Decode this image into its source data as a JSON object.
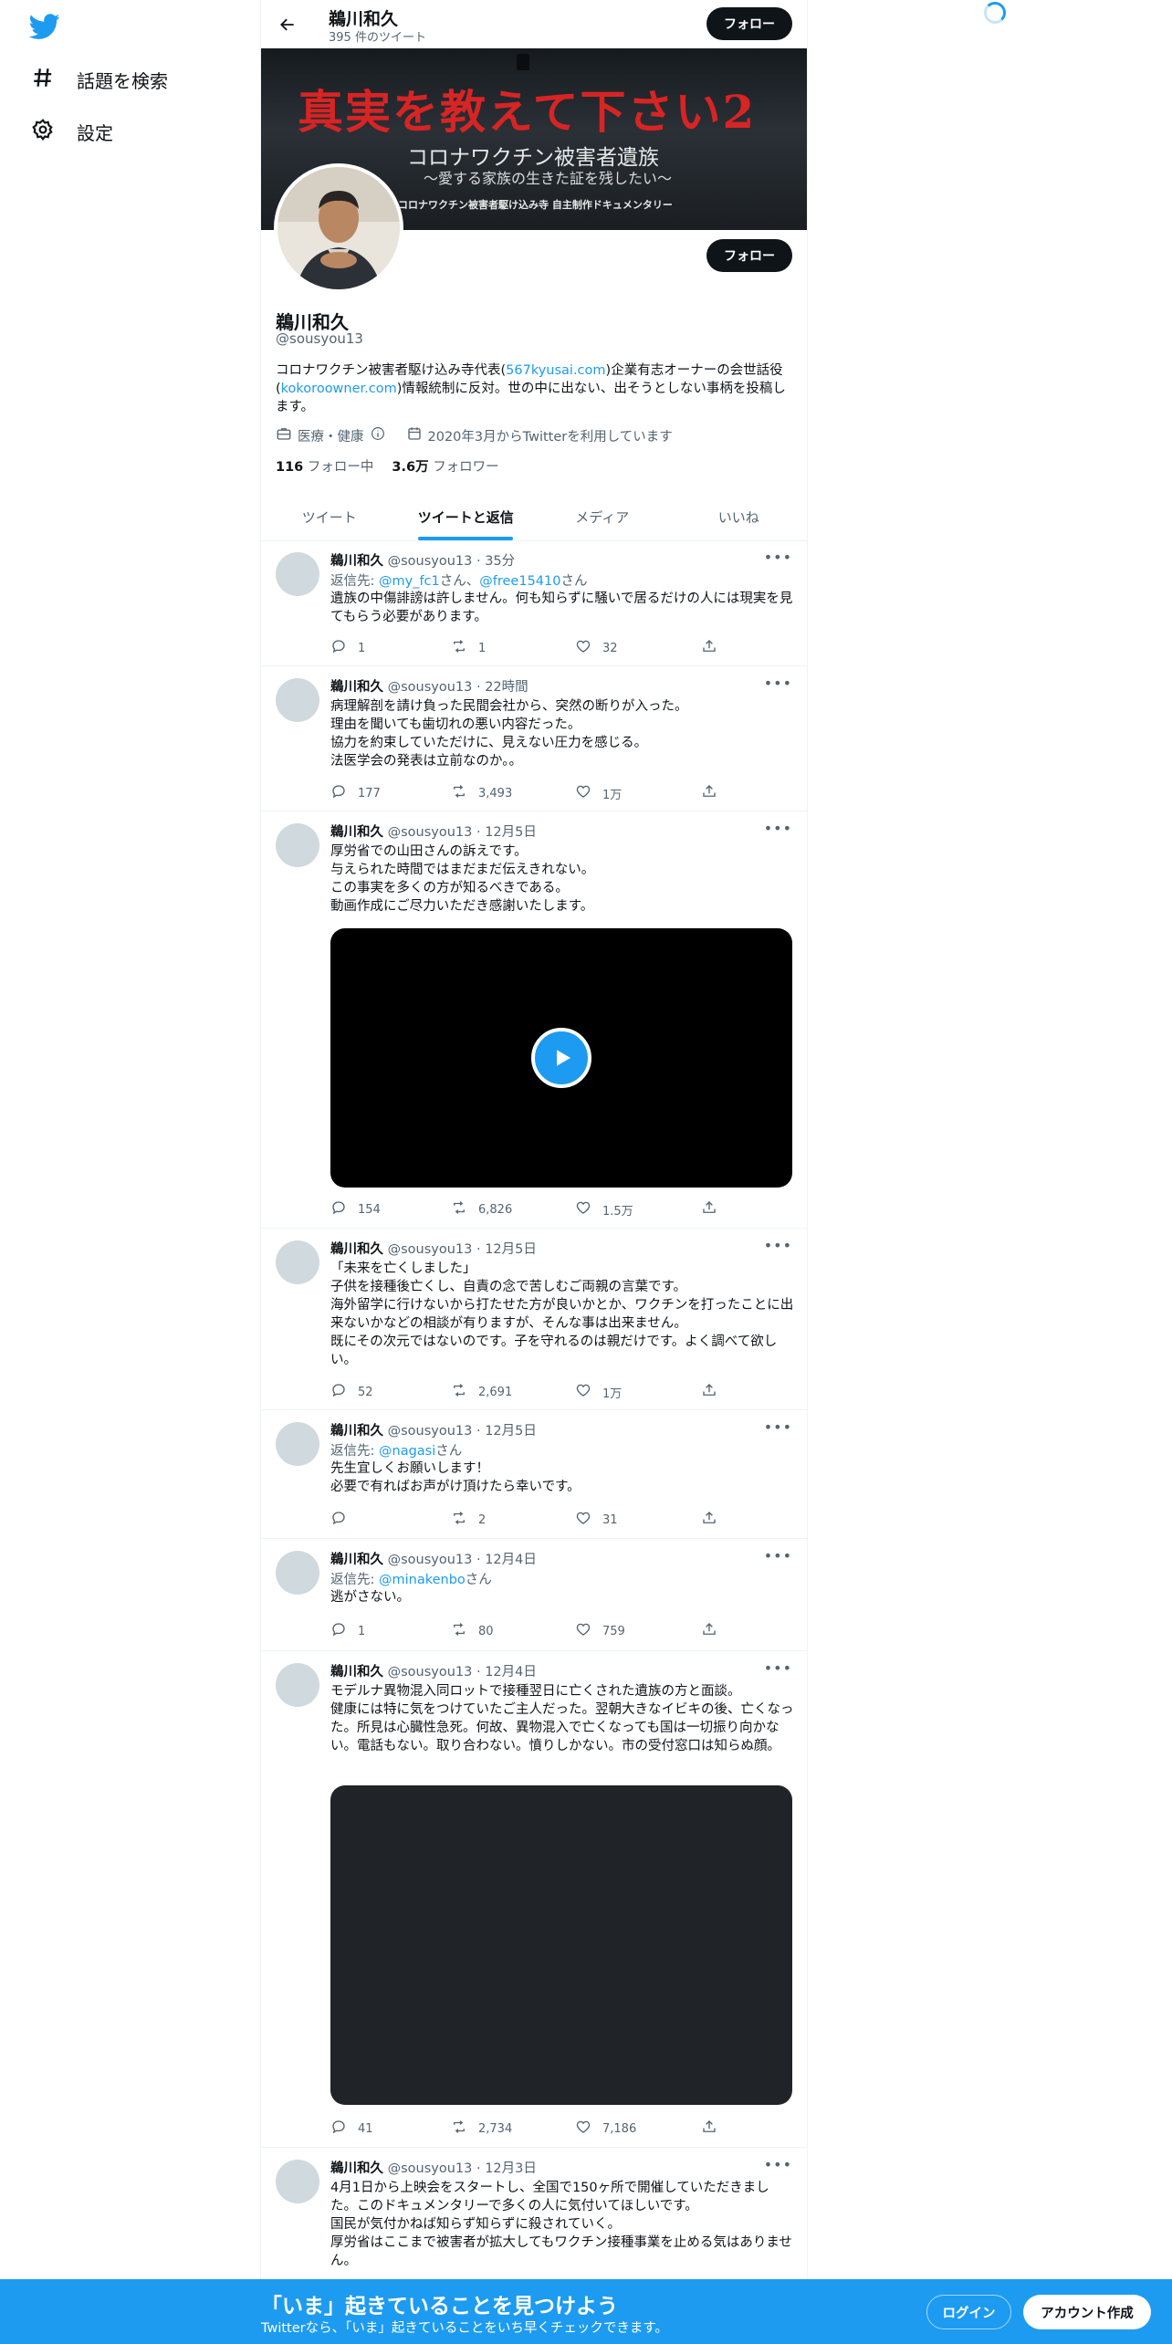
{
  "sidebar": {
    "logo": "twitter-bird-icon",
    "items": [
      {
        "label": "話題を検索",
        "icon": "hashtag-icon"
      },
      {
        "label": "設定",
        "icon": "gear-icon"
      }
    ]
  },
  "header": {
    "name": "鵜川和久",
    "tweet_count": "395 件のツイート",
    "follow_label": "フォロー"
  },
  "banner": {
    "title": "真実を教えて下さい2",
    "subtitle": "コロナワクチン被害者遺族",
    "tagline": "〜愛する家族の生きた証を残したい〜",
    "credit": "コロナワクチン被害者駆け込み寺 自主制作ドキュメンタリー"
  },
  "profile": {
    "name": "鵜川和久",
    "handle": "@sousyou13",
    "follow_label": "フォロー",
    "bio_1": "コロナワクチン被害者駆け込み寺代表(",
    "bio_link_1": "567kyusai.com",
    "bio_2": ")企業有志オーナーの会世話役(",
    "bio_link_2": "kokoroowner.com",
    "bio_3": ")情報統制に反対。世の中に出ない、出そうとしない事柄を投稿します。",
    "category": "医療・健康",
    "joined": "2020年3月からTwitterを利用しています",
    "following_count": "116",
    "following_label": "フォロー中",
    "followers_count": "3.6万",
    "followers_label": "フォロワー"
  },
  "tabs": [
    {
      "label": "ツイート",
      "active": false
    },
    {
      "label": "ツイートと返信",
      "active": true
    },
    {
      "label": "メディア",
      "active": false
    },
    {
      "label": "いいね",
      "active": false
    }
  ],
  "tweets": [
    {
      "name": "鵜川和久",
      "handle": "@sousyou13",
      "time": "35分",
      "reply_prefix": "返信先: ",
      "reply_to_1": "@my_fc1",
      "reply_mid": "さん、",
      "reply_to_2": "@free15410",
      "reply_suffix": "さん",
      "text": "遺族の中傷誹謗は許しません。何も知らずに騒いで居るだけの人には現実を見てもらう必要があります。",
      "replies": "1",
      "retweets": "1",
      "likes": "32"
    },
    {
      "name": "鵜川和久",
      "handle": "@sousyou13",
      "time": "22時間",
      "text": "病理解剖を請け負った民間会社から、突然の断りが入った。\n理由を聞いても歯切れの悪い内容だった。\n協力を約束していただけに、見えない圧力を感じる。\n法医学会の発表は立前なのか。。",
      "replies": "177",
      "retweets": "3,493",
      "likes": "1万"
    },
    {
      "name": "鵜川和久",
      "handle": "@sousyou13",
      "time": "12月5日",
      "text": "厚労省での山田さんの訴えです。\n与えられた時間ではまだまだ伝えきれない。\nこの事実を多くの方が知るべきである。\n動画作成にご尽力いただき感謝いたします。",
      "replies": "154",
      "retweets": "6,826",
      "likes": "1.5万"
    },
    {
      "name": "鵜川和久",
      "handle": "@sousyou13",
      "time": "12月5日",
      "text": "「未来を亡くしました」\n子供を接種後亡くし、自責の念で苦しむご両親の言葉です。\n海外留学に行けないから打たせた方が良いかとか、ワクチンを打ったことに出来ないかなどの相談が有りますが、そんな事は出来ません。\n既にその次元ではないのです。子を守れるのは親だけです。よく調べて欲しい。",
      "replies": "52",
      "retweets": "2,691",
      "likes": "1万"
    },
    {
      "name": "鵜川和久",
      "handle": "@sousyou13",
      "time": "12月5日",
      "reply_prefix": "返信先: ",
      "reply_to_1": "@nagasi",
      "reply_suffix": "さん",
      "text": "先生宜しくお願いします！\n必要で有ればお声がけ頂けたら幸いです。",
      "replies": "",
      "retweets": "2",
      "likes": "31"
    },
    {
      "name": "鵜川和久",
      "handle": "@sousyou13",
      "time": "12月4日",
      "reply_prefix": "返信先: ",
      "reply_to_1": "@minakenbo",
      "reply_suffix": "さん",
      "text": "逃がさない。",
      "replies": "1",
      "retweets": "80",
      "likes": "759"
    },
    {
      "name": "鵜川和久",
      "handle": "@sousyou13",
      "time": "12月4日",
      "text": "モデルナ異物混入同ロットで接種翌日に亡くされた遺族の方と面談。\n健康には特に気をつけていたご主人だった。翌朝大きなイビキの後、亡くなった。所見は心臓性急死。何故、異物混入で亡くなっても国は一切振り向かない。電話もない。取り合わない。憤りしかない。市の受付窓口は知らぬ顔。",
      "replies": "41",
      "retweets": "2,734",
      "likes": "7,186"
    },
    {
      "name": "鵜川和久",
      "handle": "@sousyou13",
      "time": "12月3日",
      "text": "4月1日から上映会をスタートし、全国で150ヶ所で開催していただきました。このドキュメンタリーで多くの人に気付いてほしいです。\n国民が気付かねば知らず知らずに殺されていく。\n厚労省はここまで被害者が拡大してもワクチン接種事業を止める気はありません。"
    }
  ],
  "bottom_bar": {
    "title": "「いま」起きていることを見つけよう",
    "subtitle": "Twitterなら、「いま」起きていることをいち早くチェックできます。",
    "login": "ログイン",
    "signup": "アカウント作成"
  },
  "colors": {
    "accent": "#1d9bf0",
    "dark": "#0f1419",
    "muted": "#536471"
  }
}
